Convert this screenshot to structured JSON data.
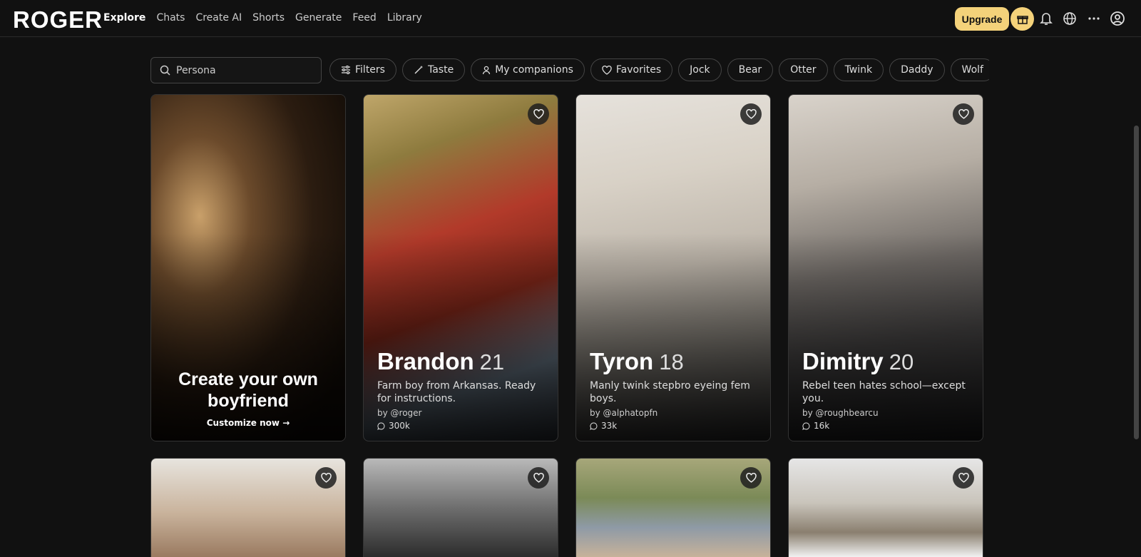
{
  "header": {
    "logo": "ROGER",
    "nav": [
      "Explore",
      "Chats",
      "Create AI",
      "Shorts",
      "Generate",
      "Feed",
      "Library"
    ],
    "active_nav": "Explore",
    "upgrade_label": "Upgrade",
    "icons": [
      "gift-icon",
      "bell-icon",
      "globe-icon",
      "more-icon",
      "account-icon"
    ]
  },
  "search": {
    "placeholder": "Persona"
  },
  "filters": {
    "buttons": [
      {
        "label": "Filters",
        "icon": "sliders-icon"
      },
      {
        "label": "Taste",
        "icon": "wand-icon"
      },
      {
        "label": "My companions",
        "icon": "person-icon"
      },
      {
        "label": "Favorites",
        "icon": "heart-icon"
      }
    ],
    "tags": [
      "Jock",
      "Bear",
      "Otter",
      "Twink",
      "Daddy",
      "Wolf"
    ]
  },
  "create_card": {
    "title_line1": "Create your own",
    "title_line2": "boyfriend",
    "link": "Customize now",
    "link_icon": "arrow-right-icon"
  },
  "companions": [
    {
      "name": "Brandon",
      "age": "21",
      "description": "Farm boy from Arkansas. Ready for instructions.",
      "author": "by @roger",
      "count": "300k"
    },
    {
      "name": "Tyron",
      "age": "18",
      "description": "Manly twink stepbro eyeing fem boys.",
      "author": "by @alphatopfn",
      "count": "33k"
    },
    {
      "name": "Dimitry",
      "age": "20",
      "description": "Rebel teen hates school—except you.",
      "author": "by @roughbearcu",
      "count": "16k"
    }
  ],
  "colors": {
    "accent": "#f4d27a",
    "background": "#111111",
    "chip_border": "#444444"
  }
}
